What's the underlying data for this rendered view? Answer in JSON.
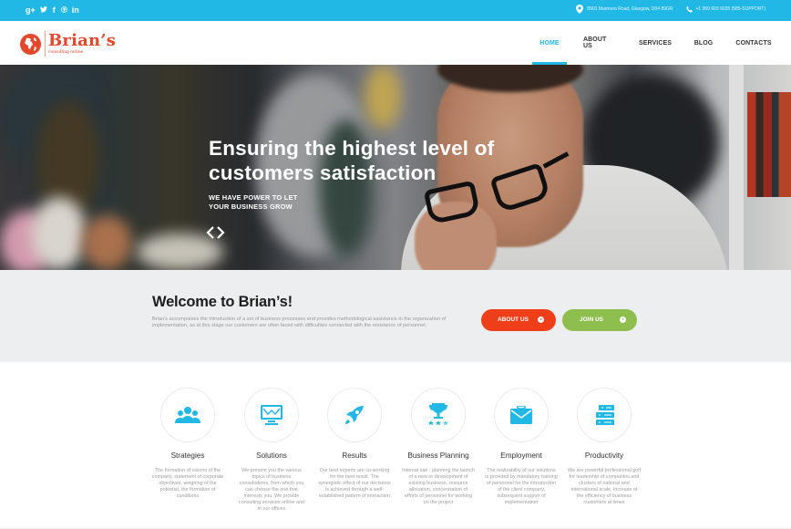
{
  "topbar": {
    "social": [
      {
        "name": "google-plus-icon",
        "glyph": "g+"
      },
      {
        "name": "twitter-icon",
        "glyph": "t"
      },
      {
        "name": "facebook-icon",
        "glyph": "f"
      },
      {
        "name": "pinterest-icon",
        "glyph": "p"
      },
      {
        "name": "linkedin-icon",
        "glyph": "in"
      }
    ],
    "address": "8901 Marmora Road, Glasgow, D04 89GR",
    "phone": "+1 959 603 6035 (585-SUPPORT)"
  },
  "header": {
    "logo_name": "Brian’s",
    "logo_tagline": "consulting online",
    "nav": [
      {
        "label": "HOME",
        "active": true
      },
      {
        "label": "ABOUT US",
        "active": false
      },
      {
        "label": "SERVICES",
        "active": false
      },
      {
        "label": "BLOG",
        "active": false
      },
      {
        "label": "CONTACTS",
        "active": false
      }
    ]
  },
  "hero": {
    "title_line1": "Ensuring the highest level of",
    "title_line2": "customers satisfaction",
    "subtitle_line1": "WE HAVE POWER TO LET",
    "subtitle_line2": "YOUR BUSINESS GROW",
    "prev_glyph": "‹",
    "next_glyph": "›"
  },
  "welcome": {
    "title": "Welcome to Brian’s!",
    "text": "Brian's accompanies the introduction of a set of business processes and provides methodological assistance in the organization of implementation, as at this stage our customers are often faced with difficulties connected with the resistance of personnel.",
    "about_button": "ABOUT US",
    "join_button": "JOIN US"
  },
  "colors": {
    "accent": "#22b8e6",
    "brand": "#e4472b",
    "about_button": "#ef3f1a",
    "join_button": "#8ebf4e",
    "welcome_bg": "#eceeef"
  },
  "features": [
    {
      "icon": "people-group-icon",
      "title": "Strategies",
      "desc": "The formation of visions of the company, statement of corporate objectives, weighing of the potential, the formation of conditions"
    },
    {
      "icon": "monitor-chart-icon",
      "title": "Solutions",
      "desc": "We present you the various topics of business consultations, from which you can choose the one that interests you. We provide consulting services online and in our offices"
    },
    {
      "icon": "rocket-icon",
      "title": "Results",
      "desc": "Our best experts are co-working for the best result. The synergistic effect of our decisions is achieved through a well-established pattern of interaction"
    },
    {
      "icon": "trophy-stars-icon",
      "title": "Business Planning",
      "desc": "Internal use - planning the launch of a new or development of existing business, resource allocation, concentration of efforts of personnel for working on the project"
    },
    {
      "icon": "briefcase-icon",
      "title": "Employment",
      "desc": "The realizability of our solutions is provided by mandatory training of personnel for the introduction of the client company, subsequent support of implementation"
    },
    {
      "icon": "server-stack-icon",
      "title": "Productivity",
      "desc": "We are powerful professional golf for leadership of companies and clusters of national and international scale, increase of the efficiency of business customers at times"
    }
  ]
}
